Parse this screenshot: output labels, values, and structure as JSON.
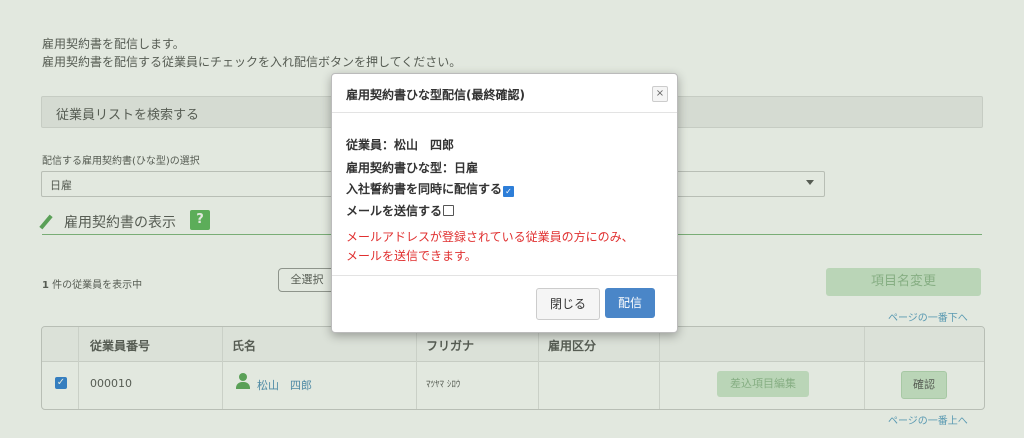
{
  "intro": {
    "line1": "雇用契約書を配信します。",
    "line2": "雇用契約書を配信する従業員にチェックを入れ配信ボタンを押してください。"
  },
  "search": {
    "label": "従業員リストを検索する"
  },
  "template_select": {
    "label": "配信する雇用契約書(ひな型)の選択",
    "value": "日雇"
  },
  "section": {
    "title": "雇用契約書の表示",
    "help_icon": "?"
  },
  "list": {
    "count": "1",
    "count_suffix": "件の従業員を表示中",
    "select_all": "全選択",
    "rename_button": "項目名変更",
    "link_bottom": "ページの一番下へ",
    "link_top": "ページの一番上へ"
  },
  "table": {
    "headers": [
      "従業員番号",
      "氏名",
      "フリガナ",
      "雇用区分"
    ],
    "rows": [
      {
        "id": "000010",
        "name": "松山　四郎",
        "furigana": "ﾏﾂﾔﾏ ｼﾛｳ",
        "category": "",
        "edit": "差込項目編集",
        "confirm": "確認"
      }
    ]
  },
  "modal": {
    "title": "雇用契約書ひな型配信(最終確認)",
    "close_icon": "×",
    "employee": "従業員：松山　四郎",
    "template": "雇用契約書ひな型：日雇",
    "pledge": "入社誓約書を同時に配信する",
    "mail": "メールを送信する",
    "warning1": "メールアドレスが登録されている従業員の方にのみ、",
    "warning2": "メールを送信できます。",
    "close_button": "閉じる",
    "send_button": "配信"
  },
  "colors": {
    "accent": "#5cb85c",
    "primary": "#4a86c8",
    "warning": "#e03030"
  }
}
